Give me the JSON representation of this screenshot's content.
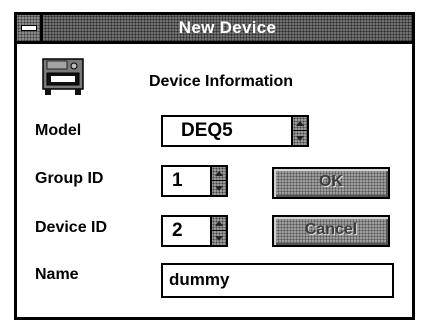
{
  "window": {
    "title": "New Device"
  },
  "section": {
    "title": "Device Information"
  },
  "form": {
    "model": {
      "label": "Model",
      "value": "DEQ5"
    },
    "group_id": {
      "label": "Group ID",
      "value": "1"
    },
    "device_id": {
      "label": "Device ID",
      "value": "2"
    },
    "name": {
      "label": "Name",
      "value": "dummy"
    }
  },
  "buttons": {
    "ok": "OK",
    "cancel": "Cancel"
  },
  "icons": {
    "system_menu": "system-menu-icon",
    "device": "disk-device-icon",
    "spin_up": "spin-up-arrow-icon",
    "spin_down": "spin-down-arrow-icon"
  }
}
